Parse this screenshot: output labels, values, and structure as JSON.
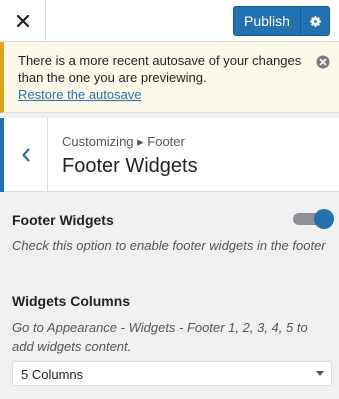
{
  "header": {
    "publish_label": "Publish"
  },
  "notice": {
    "message": "There is a more recent autosave of your changes than the one you are previewing.",
    "link_text": "Restore the autosave"
  },
  "section": {
    "breadcrumb": "Customizing ▸ Footer",
    "title": "Footer Widgets"
  },
  "controls": {
    "footer_widgets": {
      "title": "Footer Widgets",
      "description": "Check this option to enable footer widgets in the footer",
      "enabled": true
    },
    "widgets_columns": {
      "title": "Widgets Columns",
      "description": "Go to Appearance - Widgets - Footer 1, 2, 3, 4, 5 to add widgets content.",
      "selected": "5 Columns"
    }
  },
  "colors": {
    "accent": "#2271b1",
    "notice_border": "#dba617",
    "panel_bg": "#f0f0f1"
  },
  "icons": {
    "close": "close-icon",
    "settings": "gear-icon",
    "dismiss": "dismiss-icon",
    "back": "chevron-left-icon",
    "dropdown": "chevron-down-icon"
  }
}
